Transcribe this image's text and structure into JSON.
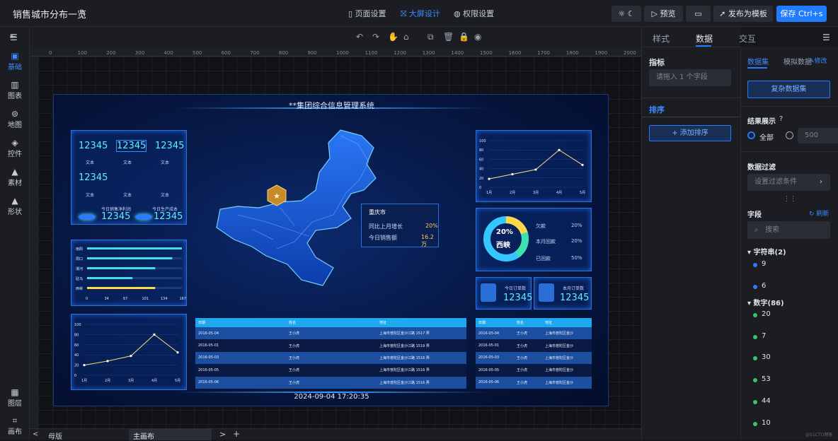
{
  "app": {
    "title": "销售城市分布一览"
  },
  "tabs": [
    {
      "label": "页面设置"
    },
    {
      "label": "大屏设计"
    },
    {
      "label": "权限设置"
    }
  ],
  "toolbar": {
    "preview": "预览",
    "publish": "发布为模板",
    "save": "保存 Ctrl+s"
  },
  "leftnav": [
    {
      "label": "基础",
      "icon": "base-icon"
    },
    {
      "label": "图表",
      "icon": "chart-icon"
    },
    {
      "label": "地图",
      "icon": "map-icon"
    },
    {
      "label": "控件",
      "icon": "widget-icon"
    },
    {
      "label": "素材",
      "icon": "material-icon"
    },
    {
      "label": "形状",
      "icon": "shape-icon"
    },
    {
      "label": "图层",
      "icon": "layer-icon"
    },
    {
      "label": "画布",
      "icon": "canvas-icon"
    }
  ],
  "ruler": [
    "0",
    "100",
    "200",
    "300",
    "400",
    "500",
    "600",
    "700",
    "800",
    "900",
    "1000",
    "1100",
    "1200",
    "1300",
    "1400",
    "1500",
    "1600",
    "1700",
    "1800",
    "1900",
    "2000"
  ],
  "screen": {
    "title": "**集团综合信息管理系统",
    "stats": {
      "v1": "12345",
      "v2": "12345",
      "v3": "12345",
      "v4": "12345",
      "label": "文本",
      "net_label": "今日销售净利润",
      "cost_label": "今日生产成本",
      "net": "12345",
      "cost": "12345"
    },
    "bar_chart": {
      "categories": [
        "南阳",
        "周口",
        "漯河",
        "驻马",
        "西峡"
      ],
      "values": [
        167,
        150,
        120,
        80,
        120
      ],
      "ticks": [
        "0",
        "34",
        "67",
        "101",
        "134",
        "167"
      ]
    },
    "line_chart_a": {
      "x": [
        "1月",
        "2月",
        "3月",
        "4月",
        "5月"
      ],
      "y": [
        20,
        28,
        38,
        80,
        45
      ],
      "yticks": [
        "100",
        "80",
        "60",
        "40",
        "20",
        "0"
      ]
    },
    "line_chart_b": {
      "x": [
        "1月",
        "2月",
        "3月",
        "4月",
        "5月"
      ],
      "y": [
        18,
        28,
        38,
        80,
        48
      ],
      "yticks": [
        "100",
        "80",
        "60",
        "40",
        "20",
        "0"
      ]
    },
    "map_popup": {
      "city": "重庆市",
      "row1_label": "同比上月增长",
      "row1_value": "20%",
      "row2_label": "今日销售额",
      "row2_value": "16.2万"
    },
    "donut": {
      "center_pct": "20%",
      "center_label": "西峡",
      "items": [
        {
          "label": "欠款",
          "value": "20%"
        },
        {
          "label": "本月回款",
          "value": "20%"
        },
        {
          "label": "已回款",
          "value": "50%"
        }
      ]
    },
    "orders": {
      "today_label": "今日订单数",
      "month_label": "本月订单数",
      "today": "12345",
      "month": "12345"
    },
    "table_headers": [
      "日期",
      "姓名",
      "地址"
    ],
    "table_rows": [
      [
        "2016-05-04",
        "王小虎",
        "上海市普陀区金沙江路 1517 弄"
      ],
      [
        "2016-05-01",
        "王小虎",
        "上海市普陀区金沙江路 1519 弄"
      ],
      [
        "2016-05-03",
        "王小虎",
        "上海市普陀区金沙江路 1516 弄"
      ],
      [
        "2016-05-05",
        "王小虎",
        "上海市普陀区金沙江路 1516 弄"
      ],
      [
        "2016-05-06",
        "王小虎",
        "上海市普陀区金沙江路 1516 弄"
      ]
    ],
    "table_rows_small": [
      [
        "2016-05-04",
        "王小虎",
        "上海市普陀区金沙"
      ],
      [
        "2016-05-01",
        "王小虎",
        "上海市普陀区金沙"
      ],
      [
        "2016-05-03",
        "王小虎",
        "上海市普陀区金沙"
      ],
      [
        "2016-05-05",
        "王小虎",
        "上海市普陀区金沙"
      ],
      [
        "2016-05-06",
        "王小虎",
        "上海市普陀区金沙"
      ]
    ],
    "datetime": "2024-09-04 17:20:35"
  },
  "bottom": {
    "prev": "<",
    "tab1": "母版",
    "tab2": "主画布",
    "next": ">",
    "add": "+"
  },
  "right": {
    "tabs": [
      "样式",
      "数据",
      "交互"
    ],
    "indicator_title": "指标",
    "indicator_placeholder": "请拖入 1 个字段",
    "sort_title": "排序",
    "add_sort": "+ 添加排序",
    "dataset_tabs": [
      "数据集",
      "模拟数据"
    ],
    "edit": "修改",
    "copy_dataset": "复杂数据集",
    "result_title": "结果展示",
    "all": "全部",
    "limit": "500",
    "filter_title": "数据过滤",
    "filter_placeholder": "设置过滤条件",
    "fields_title": "字段",
    "refresh": "刷新",
    "search": "搜索",
    "string_group": "字符串(2)",
    "string_items": [
      "9",
      "6"
    ],
    "number_group": "数字(86)",
    "number_items": [
      "20",
      "7",
      "30",
      "53",
      "44",
      "10"
    ],
    "watermark": "@51CTO博客"
  },
  "colors": {
    "accent": "#1f7cff",
    "screen_bg": "#071a48",
    "cyan": "#5ef0ff"
  }
}
